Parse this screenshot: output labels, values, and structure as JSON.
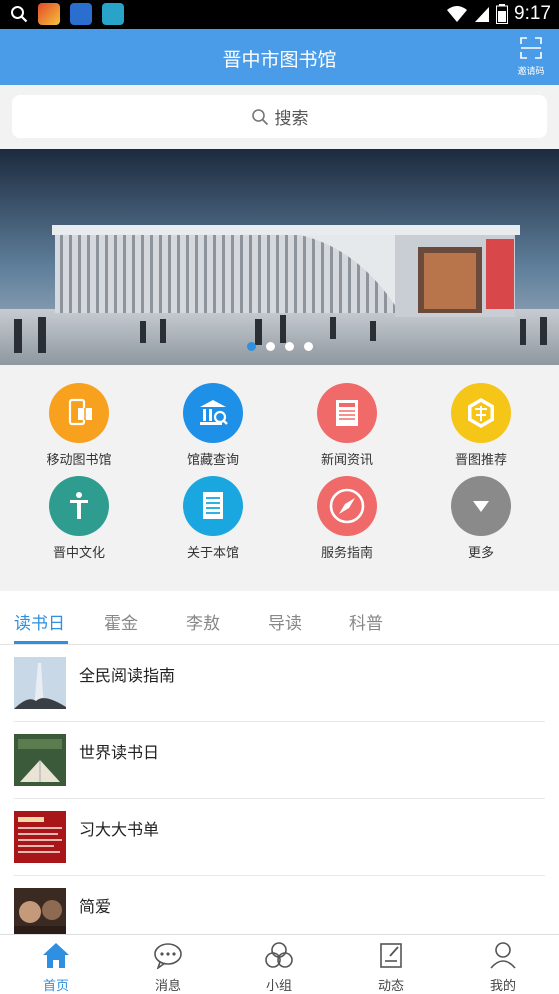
{
  "status_bar": {
    "time": "9:17"
  },
  "header": {
    "title": "晋中市图书馆",
    "invite_label": "邀请码"
  },
  "search": {
    "label": "搜索"
  },
  "quick_grid": [
    {
      "label": "移动图书馆",
      "icon": "mobile-library-icon",
      "color": "#f7a11e"
    },
    {
      "label": "馆藏查询",
      "icon": "library-building-icon",
      "color": "#1e90e8"
    },
    {
      "label": "新闻资讯",
      "icon": "news-icon",
      "color": "#f06a6a"
    },
    {
      "label": "晋图推荐",
      "icon": "recommend-icon",
      "color": "#f5c518"
    },
    {
      "label": "晋中文化",
      "icon": "culture-icon",
      "color": "#2e9d8f"
    },
    {
      "label": "关于本馆",
      "icon": "about-document-icon",
      "color": "#1aa7e0"
    },
    {
      "label": "服务指南",
      "icon": "compass-icon",
      "color": "#f06a6a"
    },
    {
      "label": "更多",
      "icon": "more-chevron-icon",
      "color": "#8a8a8a"
    }
  ],
  "tabs": [
    "读书日",
    "霍金",
    "李敖",
    "导读",
    "科普"
  ],
  "list": [
    {
      "title": "全民阅读指南"
    },
    {
      "title": "世界读书日"
    },
    {
      "title": "习大大书单"
    },
    {
      "title": "简爱"
    }
  ],
  "bottom_nav": [
    {
      "label": "首页",
      "icon": "home-icon"
    },
    {
      "label": "消息",
      "icon": "message-icon"
    },
    {
      "label": "小组",
      "icon": "group-icon"
    },
    {
      "label": "动态",
      "icon": "feed-icon"
    },
    {
      "label": "我的",
      "icon": "profile-icon"
    }
  ],
  "colors": {
    "accent": "#2f8fe0",
    "header": "#4a9ce8"
  }
}
